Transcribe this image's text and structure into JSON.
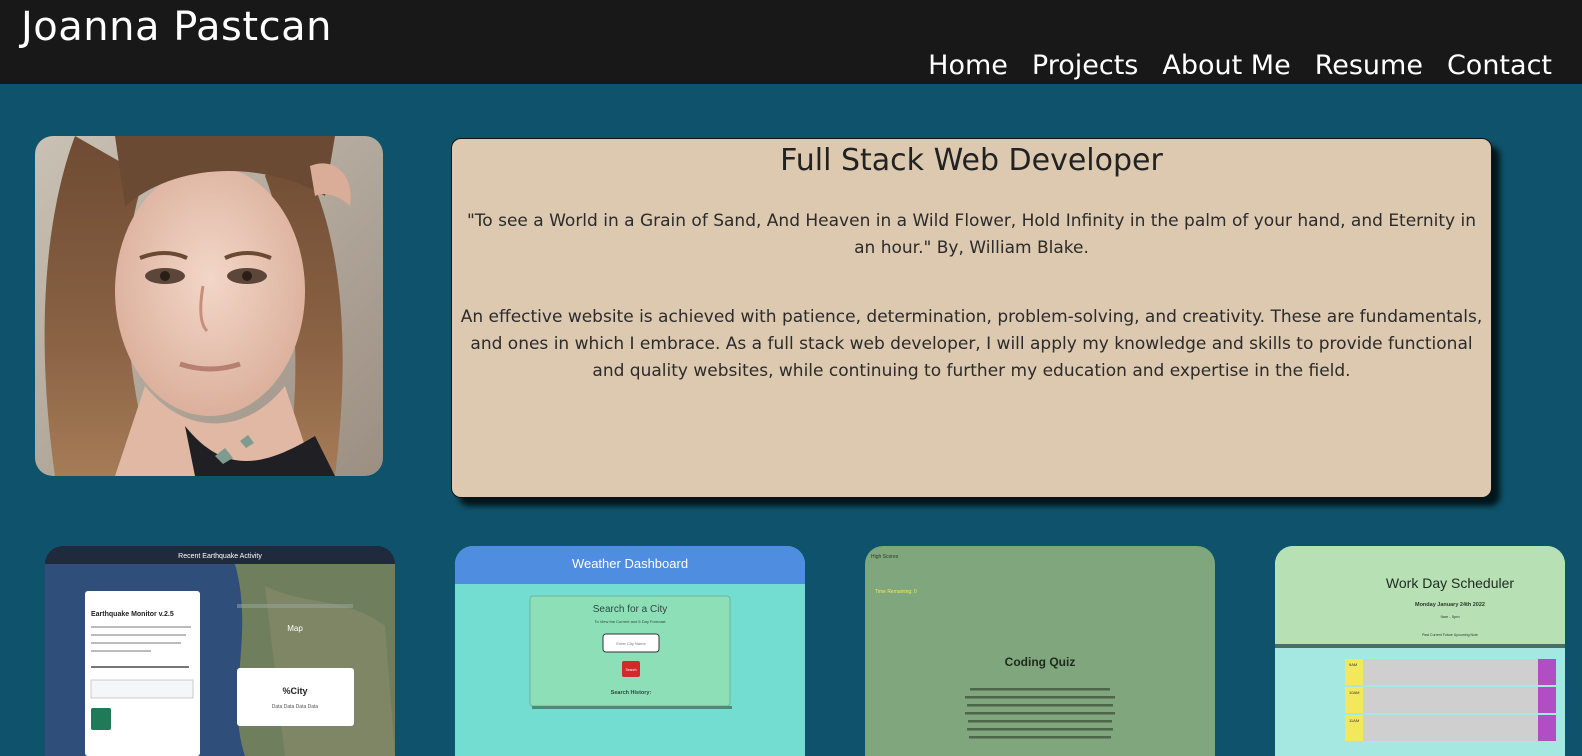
{
  "header": {
    "title": "Joanna Pastcan",
    "nav": [
      "Home",
      "Projects",
      "About Me",
      "Resume",
      "Contact"
    ]
  },
  "intro": {
    "heading": "Full Stack Web Developer",
    "quote": "\"To see a World in a Grain of Sand, And Heaven in a Wild Flower, Hold Infinity in the palm of your hand, and Eternity in an hour.\" By, William Blake.",
    "bio": "An effective website is achieved with patience, determination, problem-solving, and creativity. These are fundamentals, and ones in which I embrace. As a full stack web developer, I will apply my knowledge and skills to provide functional and quality websites, while continuing to further my education and expertise in the field."
  },
  "projects": {
    "earthquake": {
      "banner": "Recent Earthquake Activity",
      "panel_title": "Earthquake Monitor v.2.5",
      "panel_text": "Search earthquakes near you, see the most recent earthquakes available, read news related to recent tremors. Keep your family safe",
      "search_label": "Search for a City to View the Latest Earthquakes",
      "search_placeholder": "Enter City Name or Zip Code",
      "search_button": "Search",
      "map_label": "Map",
      "city_label": "%City",
      "city_data": "Data Data Data Data"
    },
    "weather": {
      "title": "Weather Dashboard",
      "search_title": "Search for a City",
      "search_subtitle": "To View the Current and 5 Day Forecast",
      "input_placeholder": "Enter City Name",
      "search_button": "Search",
      "history_label": "Search History:"
    },
    "quiz": {
      "high_scores": "High Scores",
      "time_remaining": "Time Remaining: 0",
      "title": "Coding Quiz",
      "instructions": "Try to answer the five coding questions within the time limit. You have 100 seconds. 10 seconds per question. If you answer a question incorrectly, time will be deducted. When all the questions are answered, or the timer runs out, the game is over. At the end of the game, you can save your score! The faster you can answer the questions (correctly!), the higher your score! Good luck!"
    },
    "scheduler": {
      "title": "Work Day Scheduler",
      "date": "Monday January 24th 2022",
      "hours_range": "9am - 5pm",
      "legend": "Past Current Future Upcoming Note",
      "hours": [
        "9AM",
        "10AM",
        "11AM"
      ]
    }
  },
  "colors": {
    "background": "#0e536b",
    "header": "#181818",
    "card": "#dcc9b0",
    "weather_header": "#4f8de0",
    "weather_body": "#74ddd1",
    "quiz": "#7fa67d",
    "scheduler_top": "#b7e0b5",
    "scheduler_body": "#a5e8e2"
  }
}
